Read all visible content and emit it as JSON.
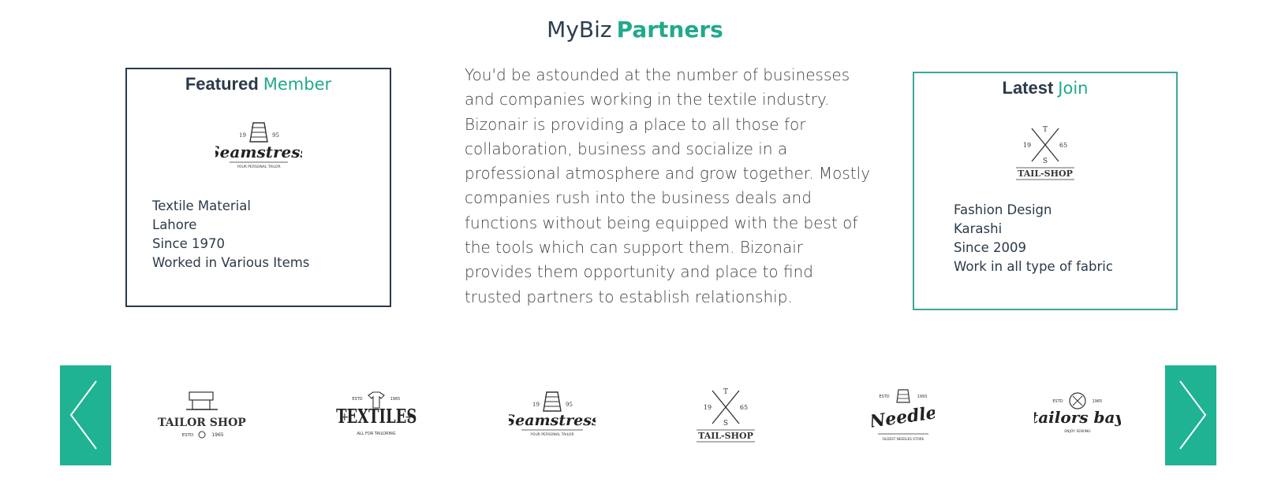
{
  "header": {
    "title_part1": "MyBiz",
    "title_part2": "Partners"
  },
  "featured": {
    "heading_strong": "Featured",
    "heading_soft": "Member",
    "logo_name": "seamstress-logo",
    "logo_text": {
      "year_left": "19",
      "year_right": "95",
      "name": "Seamstress",
      "tagline": "YOUR PERSONAL TAILOR"
    },
    "details": [
      "Textile Material",
      "Lahore",
      "Since 1970",
      "Worked in Various Items"
    ]
  },
  "description": "You'd be astounded at the number of businesses and companies working in the textile industry. Bizonair is providing a place to all those for collaboration, business and socialize in a professional atmosphere and grow together. Mostly companies rush into the business deals and functions without being equipped with the best of the tools which can support them. Bizonair provides them opportunity and place to find trusted partners to establish relationship.",
  "latest": {
    "heading_strong": "Latest",
    "heading_soft": "Join",
    "logo_name": "tail-shop-logo",
    "logo_text": {
      "top": "T",
      "left": "19",
      "right": "65",
      "bottom": "S",
      "name": "TAIL-SHOP"
    },
    "details": [
      "Fashion Design",
      "Karashi",
      "Since 2009",
      "Work in all type of fabric"
    ]
  },
  "carousel": {
    "prev_icon": "chevron-left-icon",
    "next_icon": "chevron-right-icon",
    "accent": "#1fb393",
    "logos": [
      {
        "name": "tailor-shop-logo",
        "title": "TAILOR SHOP",
        "sub": "ESTD",
        "year": "1965"
      },
      {
        "name": "textiles-logo",
        "title": "TEXTILES",
        "estd": "ESTD",
        "year": "1965",
        "sub": "ALL FOR TAILORING"
      },
      {
        "name": "seamstress-logo",
        "title": "Seamstress",
        "y1": "19",
        "y2": "95",
        "sub": "YOUR PERSONAL TAILOR"
      },
      {
        "name": "tail-shop-logo",
        "title": "TAIL-SHOP",
        "t": "T",
        "l": "19",
        "r": "65",
        "b": "S"
      },
      {
        "name": "needle-logo",
        "title": "Needle",
        "estd": "ESTD",
        "year": "1993",
        "sub": "OLDEST NEEDLES STORE"
      },
      {
        "name": "tailors-bay-logo",
        "title": "tailors bay",
        "estd": "ESTD",
        "year": "1965",
        "sub": "ENJOY SEWING"
      }
    ]
  }
}
